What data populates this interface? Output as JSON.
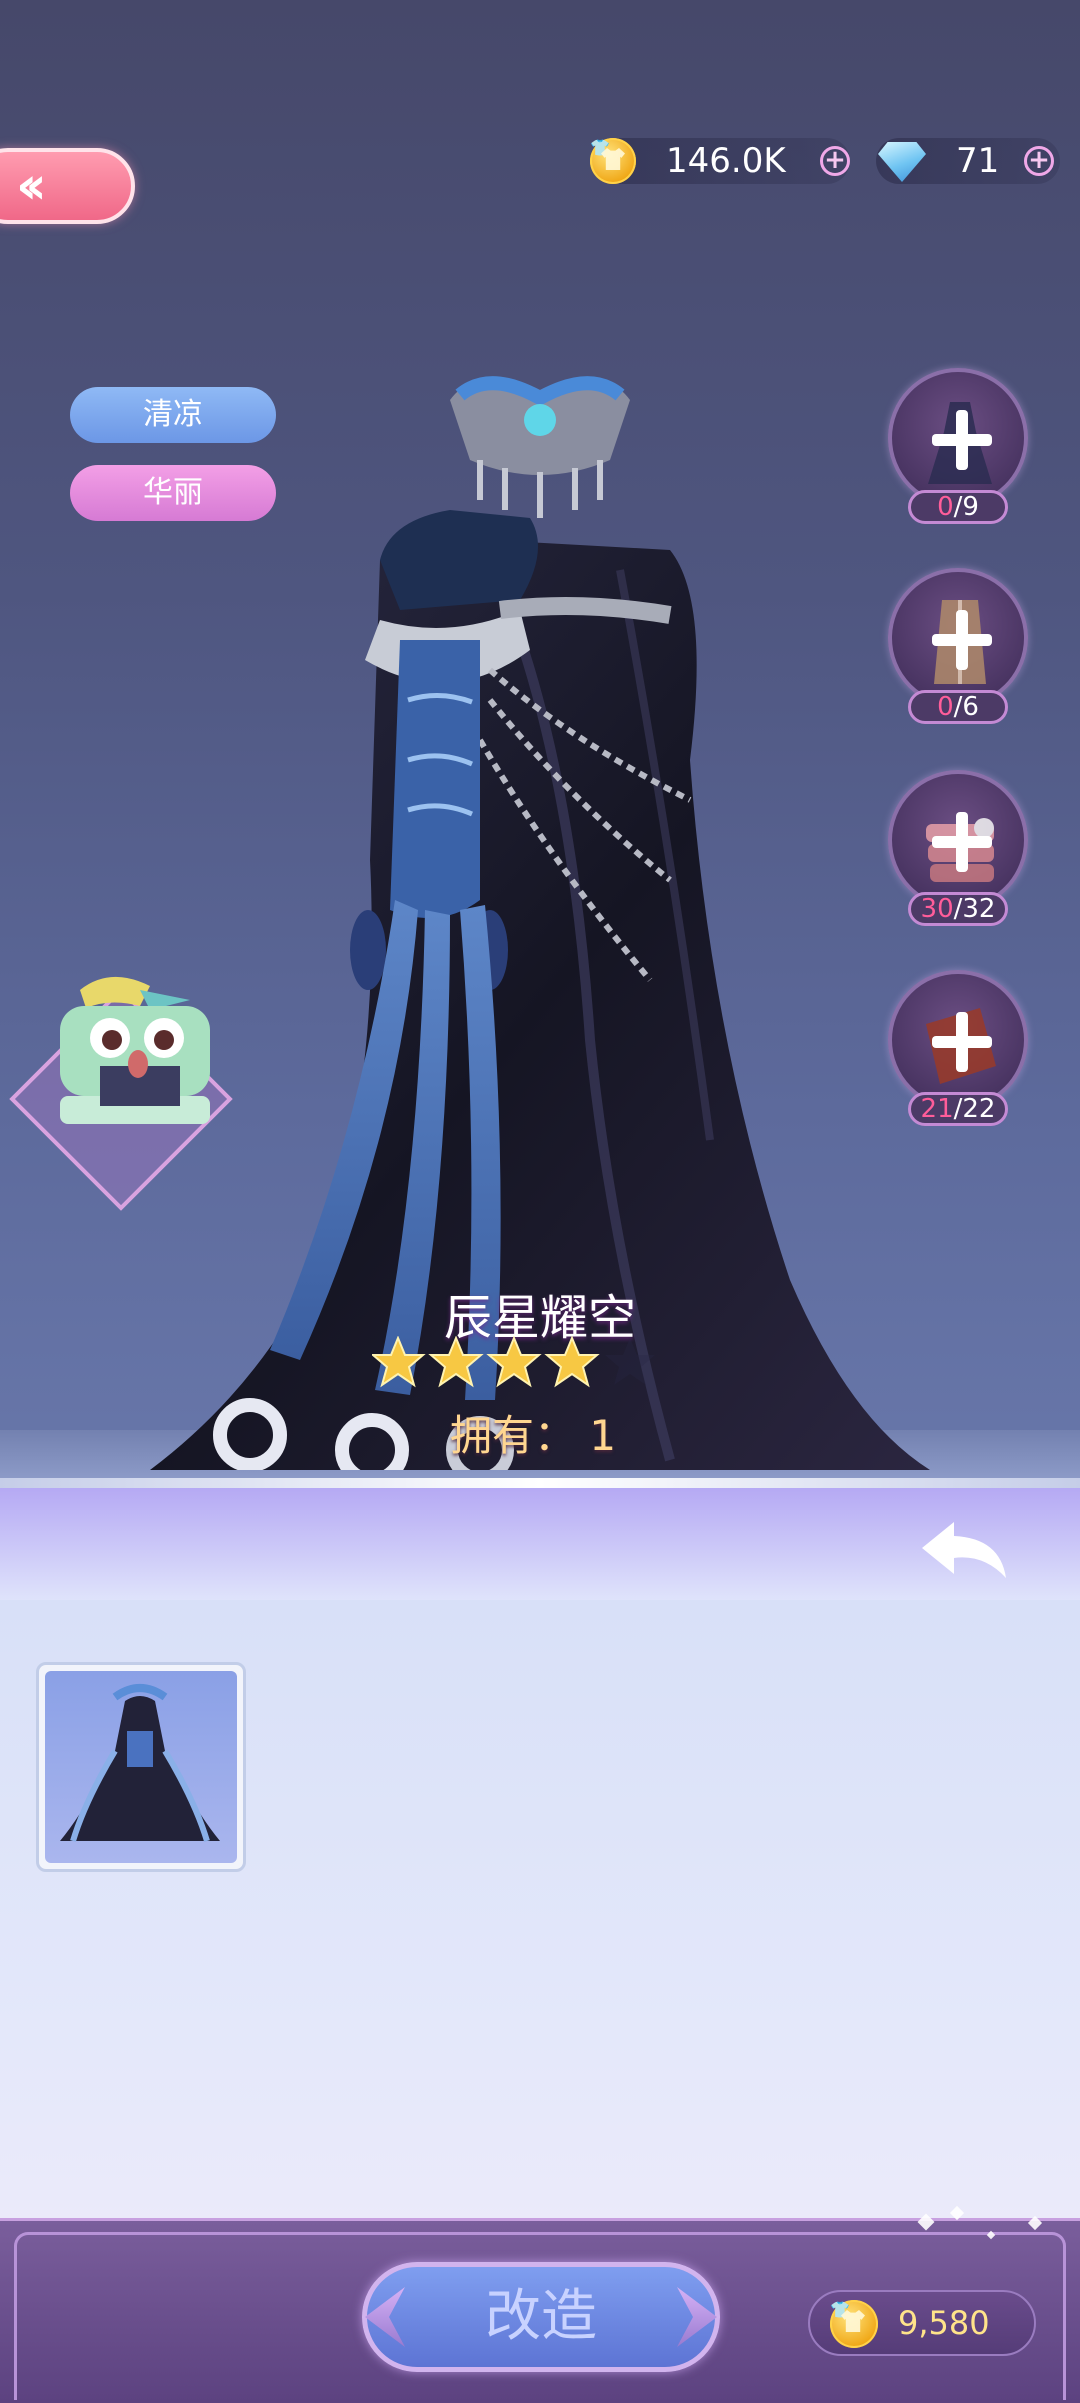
{
  "header": {
    "back_icon": "double-chevron-left-icon",
    "coins": {
      "value": "146.0K",
      "icon": "gold-shirt-coin-icon",
      "add_icon": "plus-circle-icon"
    },
    "diamonds": {
      "value": "71",
      "icon": "diamond-icon",
      "add_icon": "plus-circle-icon"
    }
  },
  "tags": [
    {
      "label": "清凉"
    },
    {
      "label": "华丽"
    }
  ],
  "materials": [
    {
      "have": "0",
      "need": "/9",
      "icon": "dress-material-icon"
    },
    {
      "have": "0",
      "need": "/6",
      "icon": "coat-material-icon"
    },
    {
      "have": "30",
      "need": "/32",
      "icon": "fabric-material-icon"
    },
    {
      "have": "21",
      "need": "/22",
      "icon": "leather-material-icon"
    }
  ],
  "item": {
    "name": "辰星耀空",
    "stars": 4,
    "max_stars": 5,
    "owned_label": "拥有：",
    "owned_count": "1"
  },
  "panel": {
    "return_icon": "return-arrow-icon",
    "items": [
      {
        "icon": "dress-thumbnail"
      }
    ]
  },
  "footer": {
    "modify_label": "改造",
    "cost": "9,580",
    "cost_icon": "gold-shirt-coin-icon"
  },
  "colors": {
    "accent_pink": "#f06888",
    "material_have": "#ff5d9a",
    "star_gold": "#f7c843",
    "panel_purple": "#b5a9f4"
  }
}
